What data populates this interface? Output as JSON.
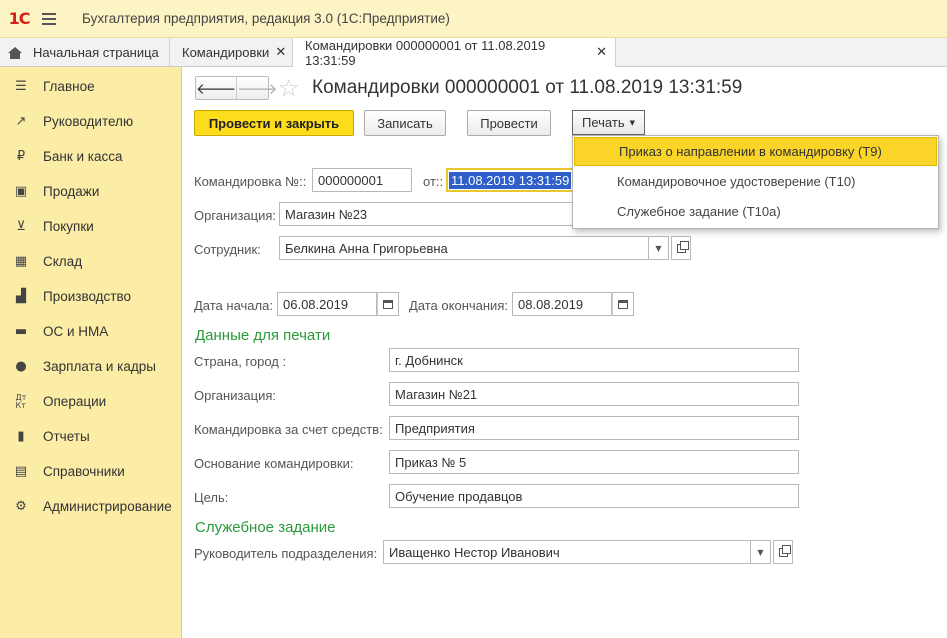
{
  "app": {
    "logo": "1С",
    "title": "Бухгалтерия предприятия, редакция 3.0  (1С:Предприятие)"
  },
  "tabs": [
    {
      "label": "Начальная страница"
    },
    {
      "label": "Командировки",
      "close": "✕"
    },
    {
      "label": "Командировки 000000001 от 11.08.2019 13:31:59",
      "close": "✕"
    }
  ],
  "sidebar": {
    "items": [
      {
        "label": "Главное",
        "icon": "list-icon"
      },
      {
        "label": "Руководителю",
        "icon": "trend-icon"
      },
      {
        "label": "Банк и касса",
        "icon": "ruble-icon"
      },
      {
        "label": "Продажи",
        "icon": "bag-icon"
      },
      {
        "label": "Покупки",
        "icon": "cart-icon"
      },
      {
        "label": "Склад",
        "icon": "grid-icon"
      },
      {
        "label": "Производство",
        "icon": "factory-icon"
      },
      {
        "label": "ОС и НМА",
        "icon": "truck-icon"
      },
      {
        "label": "Зарплата и кадры",
        "icon": "person-icon"
      },
      {
        "label": "Операции",
        "icon": "dt-kt-icon"
      },
      {
        "label": "Отчеты",
        "icon": "bar-chart-icon"
      },
      {
        "label": "Справочники",
        "icon": "book-icon"
      },
      {
        "label": "Администрирование",
        "icon": "gear-icon"
      }
    ]
  },
  "document": {
    "title": "Командировки 000000001 от 11.08.2019 13:31:59"
  },
  "toolbar": {
    "post_close": "Провести и закрыть",
    "save": "Записать",
    "post": "Провести",
    "print": "Печать"
  },
  "print_menu": {
    "items": [
      "Приказ о направлении в командировку (Т9)",
      "Командировочное удостоверение (Т10)",
      "Служебное задание (Т10а)"
    ]
  },
  "form": {
    "number_label": "Командировка №::",
    "number_value": "000000001",
    "date_label": "от::",
    "date_value": "11.08.2019 13:31:59",
    "org_label": "Организация:",
    "org_value": "Магазин №23",
    "employee_label": "Сотрудник:",
    "employee_value": "Белкина Анна Григорьевна",
    "start_label": "Дата начала:",
    "start_value": "06.08.2019",
    "end_label": "Дата окончания:",
    "end_value": "08.08.2019"
  },
  "print_data": {
    "section_title": "Данные для печати",
    "country_label": "Страна, город :",
    "country_value": "г. Добнинск",
    "org_label": "Организация:",
    "org_value": "Магазин №21",
    "funding_label": "Командировка за счет средств:",
    "funding_value": "Предприятия",
    "basis_label": "Основание командировки:",
    "basis_value": "Приказ № 5",
    "goal_label": "Цель:",
    "goal_value": "Обучение продавцов"
  },
  "task": {
    "section_title": "Служебное задание",
    "head_label": "Руководитель подразделения:",
    "head_value": "Иващенко Нестор Иванович"
  },
  "colors": {
    "titlebar": "#fcf4c4",
    "sidebar": "#fbeca6",
    "primary_button": "#fddc1b",
    "section_green": "#2a9a3a",
    "menu_highlight": "#fbd428",
    "selection": "#2f5fc8"
  }
}
